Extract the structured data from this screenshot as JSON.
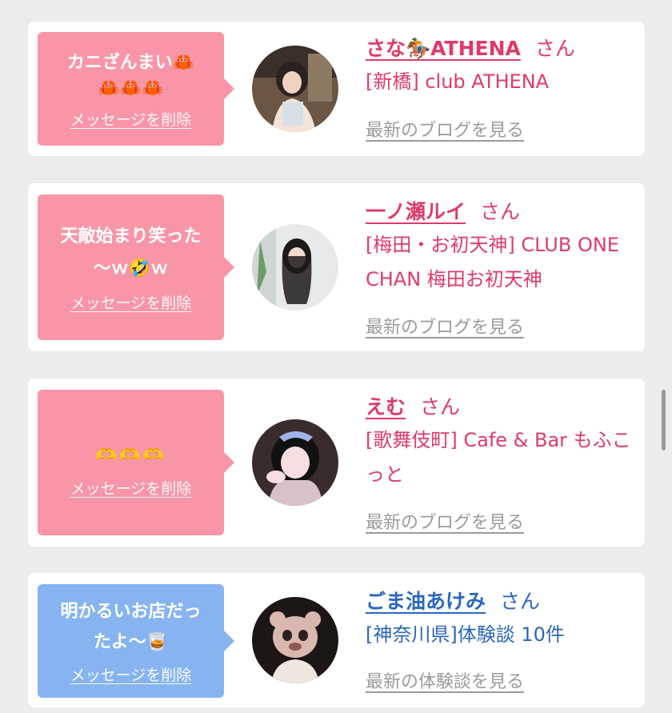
{
  "cards": [
    {
      "message": "カニざんまい🦀",
      "message2": "🦀🦀🦀",
      "delete_label": "メッセージを削除",
      "name": "さな🏇ATHENA",
      "honorific": "さん",
      "shop": "[新橋] club ATHENA",
      "link": "最新のブログを見る"
    },
    {
      "message": "天敵始まり笑った",
      "message2": "〜ｗ🤣ｗ",
      "delete_label": "メッセージを削除",
      "name": "一ノ瀬ルイ",
      "honorific": "さん",
      "shop": "[梅田・お初天神] CLUB ONE CHAN 梅田お初天神",
      "link": "最新のブログを見る"
    },
    {
      "message": "🫶🫶🫶",
      "delete_label": "メッセージを削除",
      "name": "えむ",
      "honorific": "さん",
      "shop": "[歌舞伎町] Cafe & Bar もふこっと",
      "link": "最新のブログを見る"
    },
    {
      "message": "明かるいお店だっ",
      "message2": "たよ〜🥃",
      "delete_label": "メッセージを削除",
      "name": "ごま油あけみ",
      "honorific": "さん",
      "shop": "[神奈川県]体験談 10件",
      "link": "最新の体験談を見る"
    }
  ],
  "colors": {
    "bubble_pink": "#f896a7",
    "bubble_blue": "#87b4f1",
    "name_pink": "#e03a68",
    "name_blue": "#2a66c0",
    "link_gray": "#9b9b9b",
    "page_bg": "#ececef"
  },
  "icons": [
    "horse-racing-emoji",
    "crab-emoji",
    "rolling-laughing-emoji",
    "heart-hands-emoji",
    "tumbler-glass-emoji"
  ]
}
